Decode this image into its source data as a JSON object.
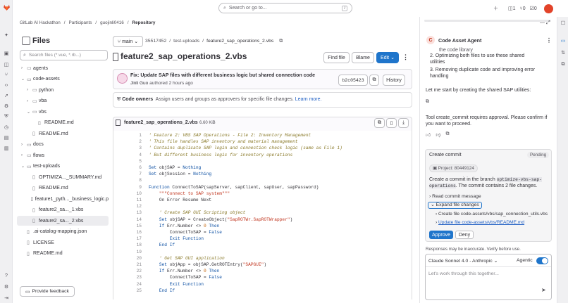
{
  "topbar": {
    "search_placeholder": "Search or go to...",
    "search_shortcut": "/",
    "counts": {
      "issues": "1",
      "mrs": "0",
      "todos": "0"
    }
  },
  "breadcrumb": [
    "GitLab AI Hackathon",
    "Participants",
    "guojinli0416",
    "Repository"
  ],
  "sidebar": {
    "title": "Files",
    "filter_placeholder": "Search files (*.vue, *.rb...)",
    "items": [
      {
        "label": "agents",
        "type": "folder",
        "open": false,
        "depth": 0
      },
      {
        "label": "code-assets",
        "type": "folder",
        "open": true,
        "depth": 0
      },
      {
        "label": "python",
        "type": "folder",
        "open": false,
        "depth": 1
      },
      {
        "label": "vba",
        "type": "folder",
        "open": false,
        "depth": 1
      },
      {
        "label": "vbs",
        "type": "folder",
        "open": true,
        "depth": 1
      },
      {
        "label": "README.md",
        "type": "file",
        "depth": 2
      },
      {
        "label": "README.md",
        "type": "file",
        "depth": 1
      },
      {
        "label": "docs",
        "type": "folder",
        "open": false,
        "depth": 0
      },
      {
        "label": "flows",
        "type": "folder",
        "open": false,
        "depth": 0
      },
      {
        "label": "test-uploads",
        "type": "folder",
        "open": true,
        "depth": 0
      },
      {
        "label": "OPTIMIZA..._SUMMARY.md",
        "type": "file",
        "depth": 1
      },
      {
        "label": "README.md",
        "type": "file",
        "depth": 1
      },
      {
        "label": "feature1_pyth..._business_logic.p",
        "type": "file",
        "depth": 1
      },
      {
        "label": "feature2_sa..._1.vbs",
        "type": "file",
        "depth": 1
      },
      {
        "label": "feature2_sa..._2.vbs",
        "type": "file",
        "depth": 1,
        "selected": true
      },
      {
        "label": ".ai-catalog-mapping.json",
        "type": "file",
        "depth": 0
      },
      {
        "label": "LICENSE",
        "type": "file",
        "depth": 0
      },
      {
        "label": "README.md",
        "type": "file",
        "depth": 0
      }
    ],
    "feedback_label": "Provide feedback"
  },
  "file": {
    "branch": "main",
    "path": [
      "35517452",
      "test-uploads",
      "feature2_sap_operations_2.vbs"
    ],
    "title": "feature2_sap_operations_2.vbs",
    "find_file": "Find file",
    "blame": "Blame",
    "edit": "Edit",
    "commit_title": "Fix: Update SAP files with different business logic but shared connection code",
    "commit_author": "Jinli Guo",
    "commit_time": "authored 2 hours ago",
    "commit_sha": "b2c05423",
    "history": "History",
    "owners_label": "Code owners",
    "owners_text": "Assign users and groups as approvers for specific file changes.",
    "owners_link": "Learn more.",
    "name": "feature2_sap_operations_2.vbs",
    "size": "6.60 KiB"
  },
  "code_lines": [
    [
      [
        "cm",
        "' Feature 2: VBS SAP Operations - File 2: Inventory Management"
      ]
    ],
    [
      [
        "cm",
        "' This file handles SAP inventory and material management"
      ]
    ],
    [
      [
        "cm",
        "' Contains duplicate SAP login and connection check logic (same as File 1)"
      ]
    ],
    [
      [
        "cm",
        "' But different business logic for inventory operations"
      ]
    ],
    [],
    [
      [
        "kw",
        "Set"
      ],
      [
        "tx",
        " objSAP = "
      ],
      [
        "kw",
        "Nothing"
      ]
    ],
    [
      [
        "kw",
        "Set"
      ],
      [
        "tx",
        " objSession = "
      ],
      [
        "kw",
        "Nothing"
      ]
    ],
    [],
    [
      [
        "kw",
        "Function"
      ],
      [
        "tx",
        " ConnectToSAP(sapServer, sapClient, sapUser, sapPassword)"
      ]
    ],
    [
      [
        "st",
        "    \"\"\"Connect to SAP system\"\"\""
      ]
    ],
    [
      [
        "tx",
        "    On Error Resume Next"
      ]
    ],
    [],
    [
      [
        "cm",
        "    ' Create SAP GUI Scripting object"
      ]
    ],
    [
      [
        "kw",
        "    Set"
      ],
      [
        "tx",
        " objSAP = CreateObject("
      ],
      [
        "st",
        "\"SapROTWr.SapROTWrapper\""
      ],
      [
        "tx",
        ")"
      ]
    ],
    [
      [
        "kw",
        "    If"
      ],
      [
        "tx",
        " Err.Number <> "
      ],
      [
        "nu",
        "0"
      ],
      [
        "kw",
        " Then"
      ]
    ],
    [
      [
        "tx",
        "        ConnectToSAP = "
      ],
      [
        "kw",
        "False"
      ]
    ],
    [
      [
        "kw",
        "        Exit Function"
      ]
    ],
    [
      [
        "kw",
        "    End If"
      ]
    ],
    [],
    [
      [
        "cm",
        "    ' Get SAP GUI application"
      ]
    ],
    [
      [
        "kw",
        "    Set"
      ],
      [
        "tx",
        " objApp = objSAP.GetROTEntry("
      ],
      [
        "st",
        "\"SAPGUI\""
      ],
      [
        "tx",
        ")"
      ]
    ],
    [
      [
        "kw",
        "    If"
      ],
      [
        "tx",
        " Err.Number <> "
      ],
      [
        "nu",
        "0"
      ],
      [
        "kw",
        " Then"
      ]
    ],
    [
      [
        "tx",
        "        ConnectToSAP = "
      ],
      [
        "kw",
        "False"
      ]
    ],
    [
      [
        "kw",
        "        Exit Function"
      ]
    ],
    [
      [
        "kw",
        "    End If"
      ]
    ]
  ],
  "agent": {
    "title": "Code Asset Agent",
    "avatar_letter": "C",
    "items": [
      "the code library",
      "2. Optimizing both files to use these shared utilities",
      "3. Removing duplicate code and improving error handling"
    ],
    "msg1": "Let me start by creating the shared SAP utilities:",
    "msg2": "Tool create_commit requires approval. Please confirm if you want to proceed.",
    "card": {
      "title": "Create commit",
      "status": "Pending",
      "project": "Project: 80449124",
      "desc_pre": "Create a commit in the branch",
      "branch": "optimize-vbs-sap-operations",
      "desc_post": ". The commit contains 2 file changes.",
      "read_msg": "Read commit message",
      "expand": "Expand file changes",
      "file1": "Create file code-assets/vbs/sap_connection_utils.vbs",
      "file2": "Update file code-assets/vbs/README.md",
      "approve": "Approve",
      "deny": "Deny"
    },
    "disclaimer": "Responses may be inaccurate. Verify before use.",
    "model": "Claude Sonnet 4.0 - Anthropic",
    "agentic": "Agentic",
    "input_placeholder": "Let's work through this together..."
  },
  "colors": {
    "accent": "#1f75cb",
    "gitlab_orange": "#e24329",
    "toggle": "#1f75cb"
  }
}
